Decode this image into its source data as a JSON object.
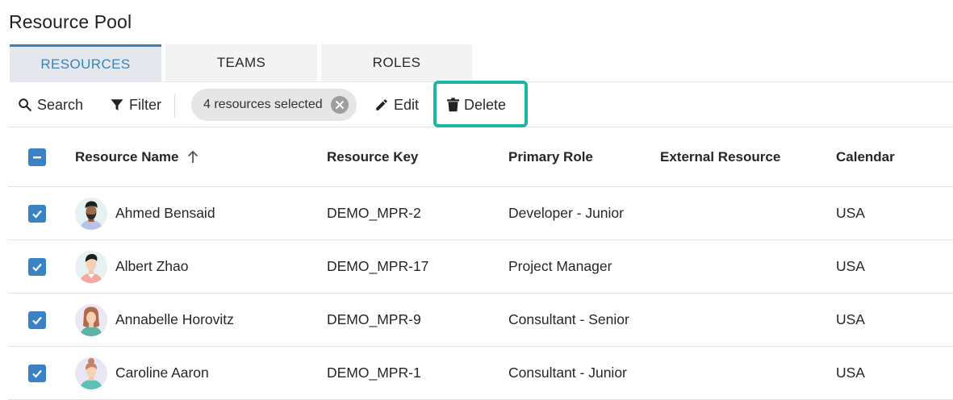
{
  "page": {
    "title": "Resource Pool"
  },
  "tabs": [
    {
      "label": "RESOURCES",
      "active": true
    },
    {
      "label": "TEAMS",
      "active": false
    },
    {
      "label": "ROLES",
      "active": false
    }
  ],
  "toolbar": {
    "search_label": "Search",
    "filter_label": "Filter",
    "selection_chip": "4 resources selected",
    "edit_label": "Edit",
    "delete_label": "Delete",
    "highlight_color": "#1fb5a6"
  },
  "table": {
    "columns": {
      "name": "Resource Name",
      "key": "Resource Key",
      "role": "Primary Role",
      "external": "External Resource",
      "calendar": "Calendar"
    },
    "sort": {
      "column": "name",
      "direction": "ascending"
    },
    "header_checkbox_state": "indeterminate",
    "rows": [
      {
        "name": "Ahmed Bensaid",
        "key": "DEMO_MPR-2",
        "role": "Developer - Junior",
        "external": "",
        "calendar": "USA",
        "checked": true,
        "avatar": "avatar-male-beard"
      },
      {
        "name": "Albert Zhao",
        "key": "DEMO_MPR-17",
        "role": "Project Manager",
        "external": "",
        "calendar": "USA",
        "checked": true,
        "avatar": "avatar-male"
      },
      {
        "name": "Annabelle Horovitz",
        "key": "DEMO_MPR-9",
        "role": "Consultant - Senior",
        "external": "",
        "calendar": "USA",
        "checked": true,
        "avatar": "avatar-female-long-hair"
      },
      {
        "name": "Caroline Aaron",
        "key": "DEMO_MPR-1",
        "role": "Consultant - Junior",
        "external": "",
        "calendar": "USA",
        "checked": true,
        "avatar": "avatar-female-bun"
      }
    ]
  },
  "colors": {
    "accent": "#3a82c4",
    "active_tab_text": "#3a82b8",
    "active_tab_bg": "#e4e8ec",
    "chip_bg": "#e6e6e6"
  }
}
